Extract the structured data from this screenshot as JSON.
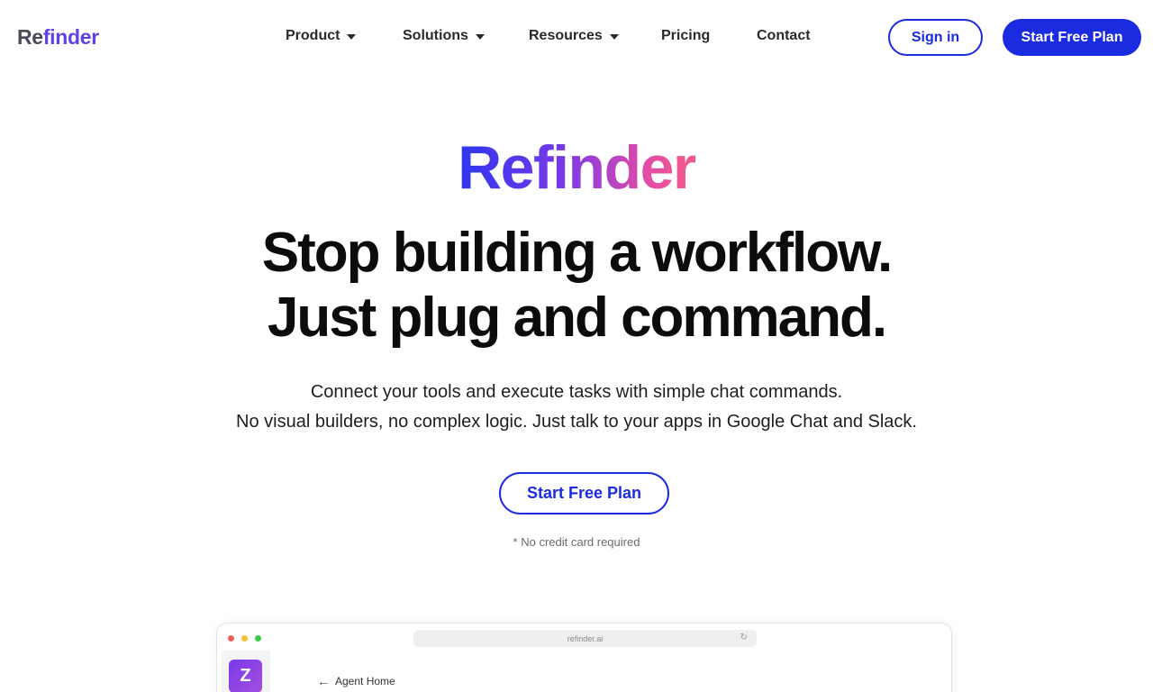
{
  "brand": {
    "logo_prefix": "Re",
    "logo_suffix": "finder",
    "accent": "#1b2be0"
  },
  "nav": {
    "items": [
      {
        "label": "Product",
        "dropdown": true
      },
      {
        "label": "Solutions",
        "dropdown": true
      },
      {
        "label": "Resources",
        "dropdown": true
      },
      {
        "label": "Pricing",
        "dropdown": false
      },
      {
        "label": "Contact",
        "dropdown": false
      }
    ],
    "signin_label": "Sign in",
    "start_label": "Start Free Plan"
  },
  "hero": {
    "brand": "Refinder",
    "headline_1": "Stop building a workflow.",
    "headline_2": "Just plug and command.",
    "sub_1": "Connect your tools and execute tasks with simple chat commands.",
    "sub_2": "No visual builders, no complex logic. Just talk to your apps in Google Chat and Slack.",
    "cta_label": "Start Free Plan",
    "note": "* No credit card required"
  },
  "preview": {
    "url": "refinder.ai",
    "avatar_letter": "Z",
    "back_label": "Agent Home"
  }
}
